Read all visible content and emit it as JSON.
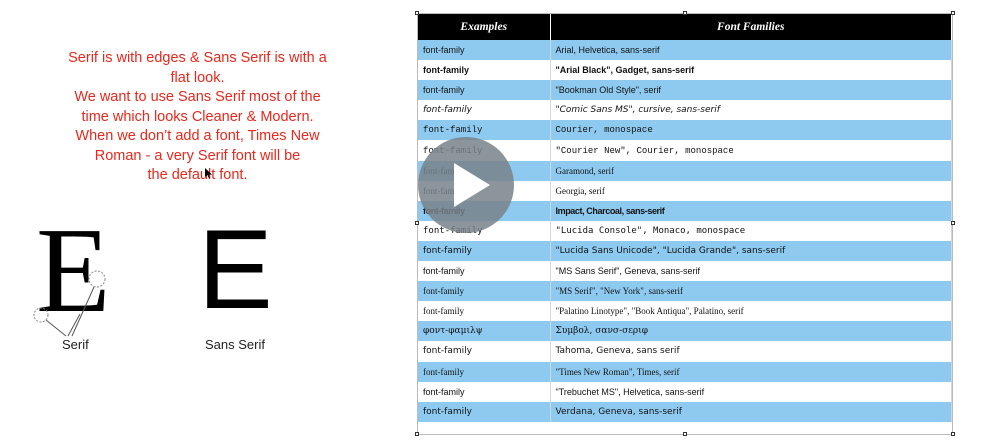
{
  "note": {
    "lines": [
      "Serif is with edges & Sans Serif is with a",
      "flat look.",
      "We want to use Sans Serif most of the",
      "time which looks Cleaner & Modern.",
      "When we don’t add a font, Times New",
      "Roman - a very Serif font will be",
      "the default font."
    ],
    "color": "#e8281c"
  },
  "demo": {
    "serif_letter": "E",
    "serif_caption": "Serif",
    "sans_letter": "E",
    "sans_caption": "Sans Serif"
  },
  "table": {
    "headers": [
      "Examples",
      "Font Families"
    ],
    "row_colors": [
      "#8ecaf0",
      "#ffffff"
    ],
    "rows": [
      {
        "example": "font-family",
        "families": "Arial, Helvetica, sans-serif"
      },
      {
        "example": "font-family",
        "families": "\"Arial Black\", Gadget, sans-serif"
      },
      {
        "example": "font-family",
        "families": "\"Bookman Old Style\", serif"
      },
      {
        "example": "font-family",
        "families": "\"Comic Sans MS\", cursive, sans-serif"
      },
      {
        "example": "font-family",
        "families": "Courier, monospace"
      },
      {
        "example": "font-family",
        "families": "\"Courier New\", Courier, monospace"
      },
      {
        "example": "font-family",
        "families": "Garamond, serif"
      },
      {
        "example": "font-family",
        "families": "Georgia, serif"
      },
      {
        "example": "font-family",
        "families": "Impact, Charcoal, sans-serif"
      },
      {
        "example": "font-family",
        "families": "\"Lucida Console\", Monaco, monospace"
      },
      {
        "example": "font-family",
        "families": "\"Lucida Sans Unicode\", \"Lucida Grande\", sans-serif"
      },
      {
        "example": "font-family",
        "families": "\"MS Sans Serif\", Geneva, sans-serif"
      },
      {
        "example": "font-family",
        "families": "\"MS Serif\", \"New York\", sans-serif"
      },
      {
        "example": "font-family",
        "families": "\"Palatino Linotype\", \"Book Antiqua\", Palatino, serif"
      },
      {
        "example": "φοντ-φαμιλψ",
        "families": "Συμβολ, σανσ-σεριφ"
      },
      {
        "example": "font-family",
        "families": "Tahoma, Geneva, sans serif"
      },
      {
        "example": "font-family",
        "families": "\"Times New Roman\", Times, serif"
      },
      {
        "example": "font-family",
        "families": "\"Trebuchet MS\", Helvetica, sans-serif"
      },
      {
        "example": "font-family",
        "families": "Verdana, Geneva, sans-serif"
      }
    ]
  },
  "video": {
    "icon": "play-icon"
  }
}
